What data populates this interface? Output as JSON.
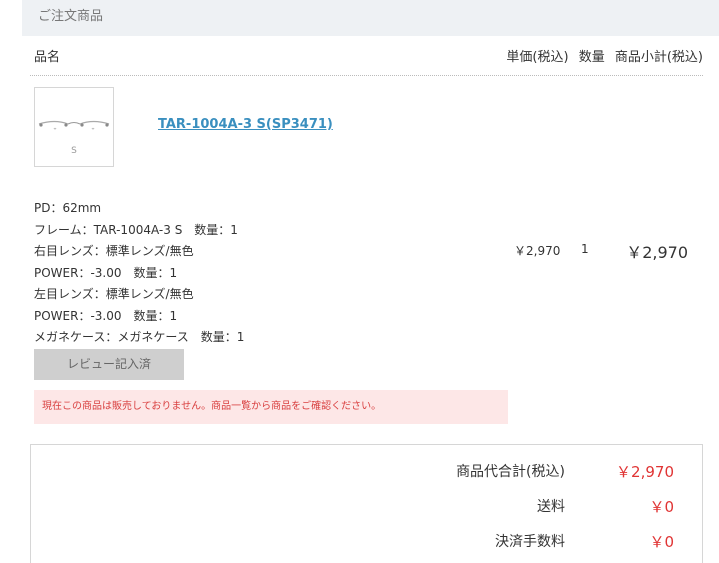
{
  "section": {
    "title": "ご注文商品"
  },
  "columns": {
    "name": "品名",
    "unit_price": "単価(税込)",
    "quantity": "数量",
    "subtotal": "商品小計(税込)"
  },
  "item": {
    "thumbnail_label": "S",
    "product_name": "TAR-1004A-3 S(SP3471)",
    "details": [
      "PD：62mm",
      "フレーム：TAR-1004A-3 S　数量：1",
      "右目レンズ：標準レンズ/無色",
      "POWER：-3.00　数量：1",
      "左目レンズ：標準レンズ/無色",
      "POWER：-3.00　数量：1",
      "メガネケース：メガネケース　数量：1"
    ],
    "unit_price": "￥2,970",
    "quantity": "1",
    "subtotal": "￥2,970",
    "review_label": "レビュー記入済",
    "notice": "現在この商品は販売しておりません。商品一覧から商品をご確認ください。"
  },
  "summary": [
    {
      "label": "商品代合計(税込)",
      "value": "￥2,970"
    },
    {
      "label": "送料",
      "value": "￥0"
    },
    {
      "label": "決済手数料",
      "value": "￥0"
    }
  ],
  "colors": {
    "header_bg": "#eef1f4",
    "link": "#3a8fbf",
    "price_red": "#e03434",
    "alert_bg": "#fde7e7",
    "alert_text": "#d94040",
    "button_bg": "#cfcfcf"
  }
}
